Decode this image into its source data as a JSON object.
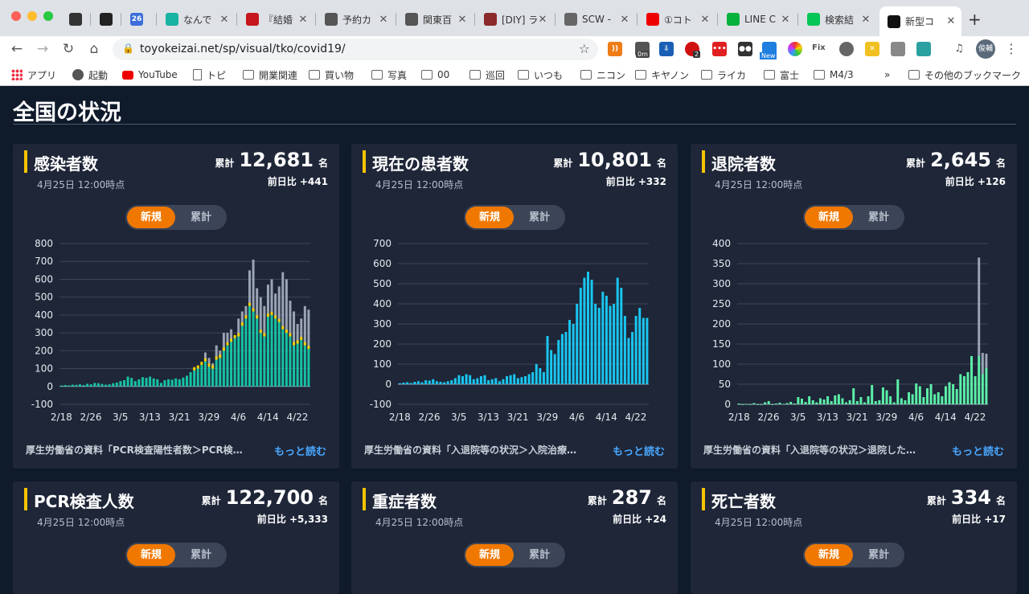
{
  "browser": {
    "tabs": [
      {
        "title": "",
        "icon": "shield-icon",
        "color": "#333333"
      },
      {
        "title": "",
        "icon": "amazon-icon",
        "color": "#222222"
      },
      {
        "title": "26",
        "icon": "calendar-icon",
        "color": "#3b6ed8"
      },
      {
        "title": "なんで",
        "icon": "page-icon",
        "color": "#17b3a3"
      },
      {
        "title": "『結婚",
        "icon": "bars-icon",
        "color": "#c4161c"
      },
      {
        "title": "予約カ",
        "icon": "globe-icon",
        "color": "#555555"
      },
      {
        "title": "関東百",
        "icon": "globe-icon",
        "color": "#555555"
      },
      {
        "title": "[DIY] ラ",
        "icon": "diy-icon",
        "color": "#8a2a2a"
      },
      {
        "title": "SCW -",
        "icon": "scw-icon",
        "color": "#666666"
      },
      {
        "title": "①コト",
        "icon": "youtube-icon",
        "color": "#ee0000"
      },
      {
        "title": "LINE C",
        "icon": "line-shield-icon",
        "color": "#06b13c"
      },
      {
        "title": "検索結",
        "icon": "line-icon",
        "color": "#06c755"
      },
      {
        "title": "新型コ",
        "icon": "tk-icon",
        "color": "#111111"
      }
    ],
    "url": "toyokeizai.net/sp/visual/tko/covid19/",
    "bookmarks": [
      "アプリ",
      "起動",
      "YouTube",
      "トピ",
      "開業関連",
      "買い物",
      "写真",
      "00",
      "巡回",
      "いつも",
      "ニコン",
      "キヤノン",
      "ライカ",
      "富士",
      "M4/3",
      "»",
      "その他のブックマーク"
    ],
    "ext_badges": {
      "timer": "0m",
      "count": "2",
      "new": "New",
      "fix": "Fix",
      "profile": "俊輔"
    }
  },
  "page": {
    "title": "全国の状況"
  },
  "common": {
    "asof": "4月25日 12:00時点",
    "total_label": "累計",
    "unit": "名",
    "toggle_new": "新規",
    "toggle_cum": "累計",
    "more": "もっと読む"
  },
  "cards": [
    {
      "name": "感染者数",
      "total": "12,681",
      "delta": "前日比 +441",
      "source": "厚生労働省の資料「PCR検査陽性者数＞PCR検…"
    },
    {
      "name": "現在の患者数",
      "total": "10,801",
      "delta": "前日比 +332",
      "source": "厚生労働省の資料「入退院等の状況＞入院治療…"
    },
    {
      "name": "退院者数",
      "total": "2,645",
      "delta": "前日比 +126",
      "source": "厚生労働省の資料「入退院等の状況＞退院した…"
    },
    {
      "name": "PCR検査人数",
      "total": "122,700",
      "delta": "前日比 +5,333"
    },
    {
      "name": "重症者数",
      "total": "287",
      "delta": "前日比 +24"
    },
    {
      "name": "死亡者数",
      "total": "334",
      "delta": "前日比 +17"
    }
  ],
  "chart_data": [
    {
      "type": "bar",
      "title": "",
      "x_tick_labels": [
        "2/18",
        "2/26",
        "3/5",
        "3/13",
        "3/21",
        "3/29",
        "4/6",
        "4/14",
        "4/22"
      ],
      "ylim": [
        -100,
        800
      ],
      "yticks": [
        -100,
        0,
        100,
        200,
        300,
        400,
        500,
        600,
        700,
        800
      ],
      "series_colors": {
        "new": "#16c2a3",
        "accent": "#f5d000",
        "cumulative": "#9aa4b4"
      },
      "x": [
        "2/18",
        "2/19",
        "2/20",
        "2/21",
        "2/22",
        "2/23",
        "2/24",
        "2/25",
        "2/26",
        "2/27",
        "2/28",
        "2/29",
        "3/1",
        "3/2",
        "3/3",
        "3/4",
        "3/5",
        "3/6",
        "3/7",
        "3/8",
        "3/9",
        "3/10",
        "3/11",
        "3/12",
        "3/13",
        "3/14",
        "3/15",
        "3/16",
        "3/17",
        "3/18",
        "3/19",
        "3/20",
        "3/21",
        "3/22",
        "3/23",
        "3/24",
        "3/25",
        "3/26",
        "3/27",
        "3/28",
        "3/29",
        "3/30",
        "3/31",
        "4/1",
        "4/2",
        "4/3",
        "4/4",
        "4/5",
        "4/6",
        "4/7",
        "4/8",
        "4/9",
        "4/10",
        "4/11",
        "4/12",
        "4/13",
        "4/14",
        "4/15",
        "4/16",
        "4/17",
        "4/18",
        "4/19",
        "4/20",
        "4/21",
        "4/22",
        "4/23",
        "4/24",
        "4/25"
      ],
      "values": [
        5,
        8,
        6,
        10,
        9,
        12,
        8,
        15,
        12,
        20,
        18,
        14,
        10,
        12,
        18,
        22,
        30,
        35,
        55,
        48,
        30,
        40,
        52,
        48,
        55,
        45,
        40,
        20,
        35,
        40,
        38,
        45,
        40,
        50,
        60,
        80,
        90,
        100,
        120,
        140,
        110,
        100,
        150,
        160,
        200,
        230,
        250,
        270,
        280,
        340,
        380,
        450,
        420,
        380,
        300,
        280,
        390,
        400,
        380,
        360,
        320,
        300,
        280,
        230,
        240,
        260,
        230,
        210
      ],
      "values_top": [
        5,
        8,
        6,
        10,
        9,
        12,
        8,
        15,
        12,
        20,
        18,
        14,
        10,
        12,
        18,
        22,
        30,
        35,
        55,
        48,
        30,
        40,
        52,
        48,
        55,
        45,
        40,
        -20,
        35,
        40,
        38,
        45,
        40,
        50,
        60,
        80,
        90,
        100,
        120,
        190,
        160,
        130,
        230,
        200,
        300,
        300,
        320,
        280,
        380,
        420,
        450,
        650,
        710,
        550,
        500,
        450,
        570,
        600,
        520,
        560,
        640,
        600,
        480,
        420,
        350,
        380,
        450,
        430
      ]
    },
    {
      "type": "bar",
      "title": "",
      "x_tick_labels": [
        "2/18",
        "2/26",
        "3/5",
        "3/13",
        "3/21",
        "3/29",
        "4/6",
        "4/14",
        "4/22"
      ],
      "ylim": [
        -100,
        700
      ],
      "yticks": [
        -100,
        0,
        100,
        200,
        300,
        400,
        500,
        600,
        700
      ],
      "series_colors": {
        "values": "#19c6f0"
      },
      "x": [
        "2/18",
        "2/19",
        "2/20",
        "2/21",
        "2/22",
        "2/23",
        "2/24",
        "2/25",
        "2/26",
        "2/27",
        "2/28",
        "2/29",
        "3/1",
        "3/2",
        "3/3",
        "3/4",
        "3/5",
        "3/6",
        "3/7",
        "3/8",
        "3/9",
        "3/10",
        "3/11",
        "3/12",
        "3/13",
        "3/14",
        "3/15",
        "3/16",
        "3/17",
        "3/18",
        "3/19",
        "3/20",
        "3/21",
        "3/22",
        "3/23",
        "3/24",
        "3/25",
        "3/26",
        "3/27",
        "3/28",
        "3/29",
        "3/30",
        "3/31",
        "4/1",
        "4/2",
        "4/3",
        "4/4",
        "4/5",
        "4/6",
        "4/7",
        "4/8",
        "4/9",
        "4/10",
        "4/11",
        "4/12",
        "4/13",
        "4/14",
        "4/15",
        "4/16",
        "4/17",
        "4/18",
        "4/19",
        "4/20",
        "4/21",
        "4/22",
        "4/23",
        "4/24",
        "4/25"
      ],
      "values": [
        5,
        8,
        10,
        6,
        12,
        15,
        10,
        20,
        18,
        25,
        15,
        12,
        10,
        15,
        20,
        30,
        45,
        40,
        50,
        45,
        25,
        30,
        40,
        45,
        20,
        25,
        30,
        15,
        25,
        40,
        45,
        50,
        30,
        35,
        40,
        50,
        60,
        100,
        80,
        60,
        240,
        170,
        150,
        220,
        250,
        260,
        320,
        300,
        400,
        480,
        530,
        560,
        520,
        400,
        380,
        460,
        440,
        390,
        400,
        530,
        480,
        340,
        230,
        260,
        340,
        380,
        330,
        330
      ]
    },
    {
      "type": "bar",
      "title": "",
      "x_tick_labels": [
        "2/18",
        "2/26",
        "3/5",
        "3/13",
        "3/21",
        "3/29",
        "4/6",
        "4/14",
        "4/22"
      ],
      "ylim": [
        0,
        400
      ],
      "yticks": [
        0,
        50,
        100,
        150,
        200,
        250,
        300,
        350,
        400
      ],
      "series_colors": {
        "values": "#5cf0a8",
        "spike": "#9aa4b4"
      },
      "x": [
        "2/18",
        "2/19",
        "2/20",
        "2/21",
        "2/22",
        "2/23",
        "2/24",
        "2/25",
        "2/26",
        "2/27",
        "2/28",
        "2/29",
        "3/1",
        "3/2",
        "3/3",
        "3/4",
        "3/5",
        "3/6",
        "3/7",
        "3/8",
        "3/9",
        "3/10",
        "3/11",
        "3/12",
        "3/13",
        "3/14",
        "3/15",
        "3/16",
        "3/17",
        "3/18",
        "3/19",
        "3/20",
        "3/21",
        "3/22",
        "3/23",
        "3/24",
        "3/25",
        "3/26",
        "3/27",
        "3/28",
        "3/29",
        "3/30",
        "3/31",
        "4/1",
        "4/2",
        "4/3",
        "4/4",
        "4/5",
        "4/6",
        "4/7",
        "4/8",
        "4/9",
        "4/10",
        "4/11",
        "4/12",
        "4/13",
        "4/14",
        "4/15",
        "4/16",
        "4/17",
        "4/18",
        "4/19",
        "4/20",
        "4/21",
        "4/22",
        "4/23",
        "4/24",
        "4/25"
      ],
      "values": [
        2,
        0,
        1,
        0,
        3,
        0,
        0,
        5,
        8,
        0,
        2,
        4,
        1,
        3,
        6,
        2,
        18,
        14,
        6,
        20,
        10,
        5,
        15,
        12,
        20,
        8,
        22,
        25,
        15,
        5,
        10,
        40,
        8,
        18,
        5,
        20,
        48,
        8,
        10,
        42,
        35,
        20,
        5,
        62,
        15,
        10,
        30,
        25,
        52,
        45,
        18,
        40,
        50,
        25,
        30,
        20,
        45,
        55,
        50,
        38,
        75,
        70,
        80,
        120,
        70,
        120,
        75,
        90
      ],
      "values_top": [
        2,
        0,
        1,
        0,
        3,
        0,
        0,
        5,
        8,
        0,
        2,
        4,
        1,
        3,
        6,
        2,
        18,
        14,
        6,
        20,
        10,
        5,
        15,
        12,
        20,
        8,
        22,
        25,
        15,
        5,
        10,
        40,
        8,
        18,
        5,
        20,
        48,
        8,
        10,
        42,
        35,
        20,
        5,
        62,
        15,
        10,
        30,
        25,
        52,
        45,
        18,
        40,
        50,
        25,
        30,
        20,
        45,
        55,
        50,
        38,
        75,
        70,
        80,
        120,
        70,
        365,
        128,
        126
      ]
    }
  ]
}
